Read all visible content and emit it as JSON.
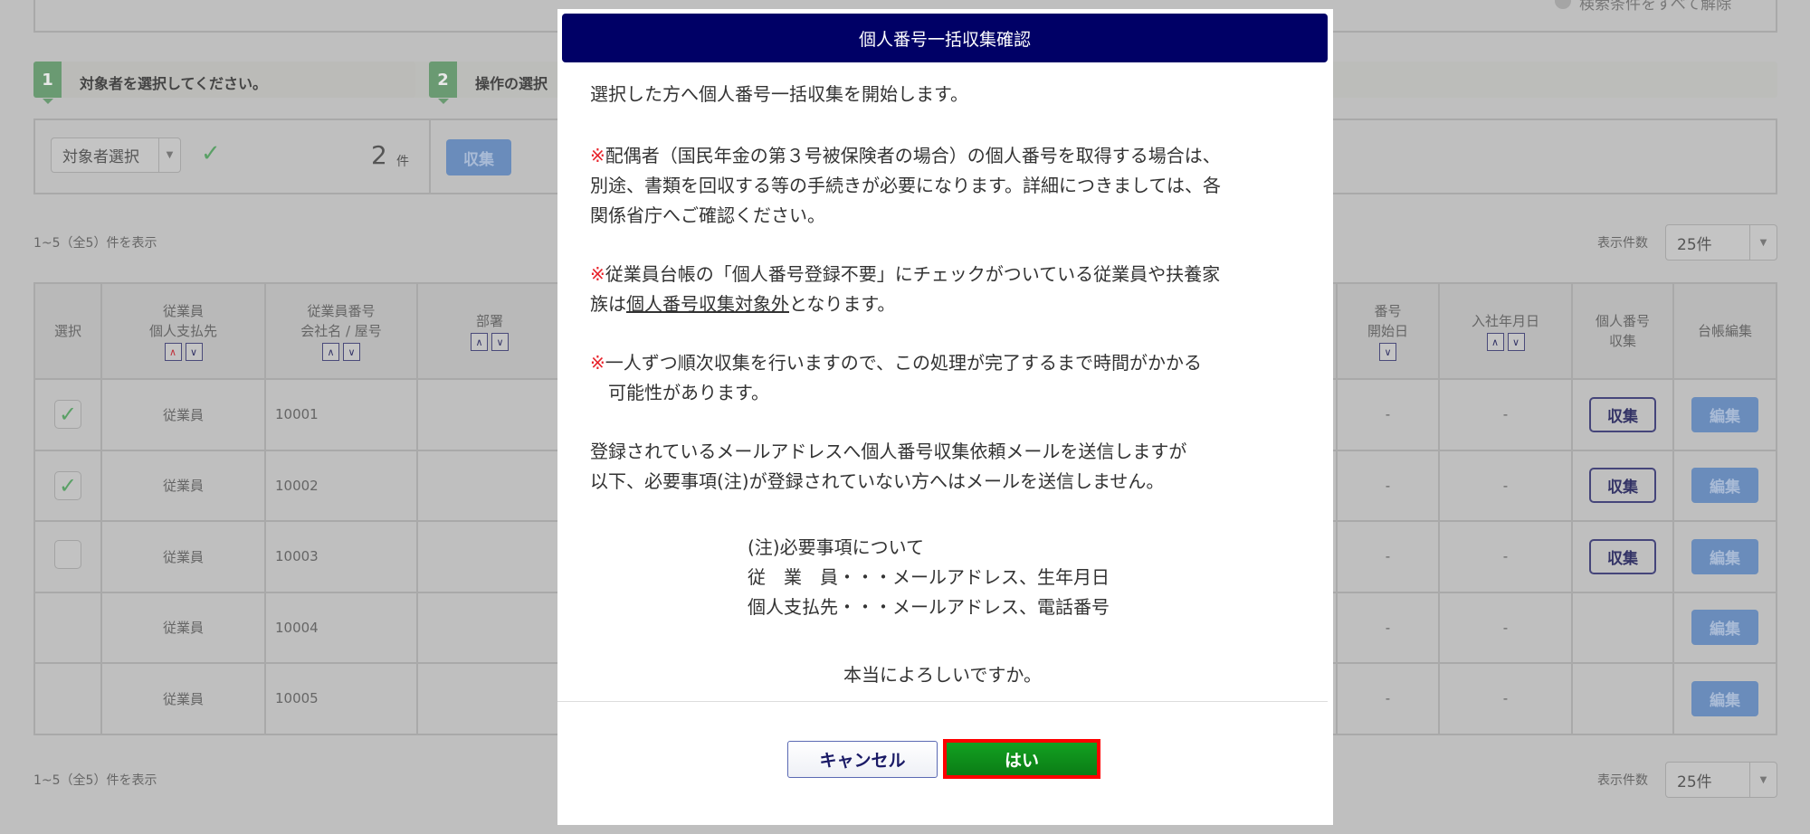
{
  "header": {
    "clear_conditions": "検索条件をすべて解除"
  },
  "steps": [
    {
      "num": "1",
      "label": "対象者を選択してください。"
    },
    {
      "num": "2",
      "label": "操作の選択"
    }
  ],
  "panel": {
    "target_select": "対象者選択",
    "count": "2",
    "count_unit": "件",
    "collect_button": "収集"
  },
  "list": {
    "range_text": "1~5（全5）件を表示",
    "per_page_label": "表示件数",
    "per_page_value": "25件",
    "columns": {
      "select": "選択",
      "type1": "従業員",
      "type2": "個人支払先",
      "num1": "従業員番号",
      "num2": "会社名 / 屋号",
      "dept": "部署",
      "start1": "番号",
      "start2": "開始日",
      "joined": "入社年月日",
      "mynum1": "個人番号",
      "mynum2": "収集",
      "edit": "台帳編集"
    },
    "rows": [
      {
        "type": "従業員",
        "number": "10001",
        "start": "-",
        "joined": "-",
        "collect": "収集",
        "edit": "編集"
      },
      {
        "type": "従業員",
        "number": "10002",
        "start": "-",
        "joined": "-",
        "collect": "収集",
        "edit": "編集"
      },
      {
        "type": "従業員",
        "number": "10003",
        "start": "-",
        "joined": "-",
        "collect": "収集",
        "edit": "編集"
      },
      {
        "type": "従業員",
        "number": "10004",
        "start": "-",
        "joined": "-",
        "edit": "編集"
      },
      {
        "type": "従業員",
        "number": "10005",
        "start": "-",
        "joined": "-",
        "edit": "編集"
      }
    ]
  },
  "dialog": {
    "title": "個人番号一括収集確認",
    "intro": "選択した方へ個人番号一括収集を開始します。",
    "mark": "※",
    "p2": [
      "配偶者（国民年金の第３号被保険者の場合）の個人番号を取得する場合は、",
      "別途、書類を回収する等の手続きが必要になります。詳細につきましては、各",
      "関係省庁へご確認ください。"
    ],
    "p3a": "従業員台帳の「個人番号登録不要」にチェックがついている従業員や扶養家",
    "p3b_pre": "族は",
    "p3b_link": "個人番号収集対象外",
    "p3b_post": "となります。",
    "p4": [
      "一人ずつ順次収集を行いますので、この処理が完了するまで時間がかかる",
      "　可能性があります。"
    ],
    "p5": [
      "登録されているメールアドレスへ個人番号収集依頼メールを送信しますが",
      "以下、必要事項(注)が登録されていない方へはメールを送信しません。"
    ],
    "note": [
      "(注)必要事項について",
      "従　業　員・・・メールアドレス、生年月日",
      "個人支払先・・・メールアドレス、電話番号"
    ],
    "confirm": "本当によろしいですか。",
    "cancel_label": "キャンセル",
    "yes_label": "はい"
  }
}
